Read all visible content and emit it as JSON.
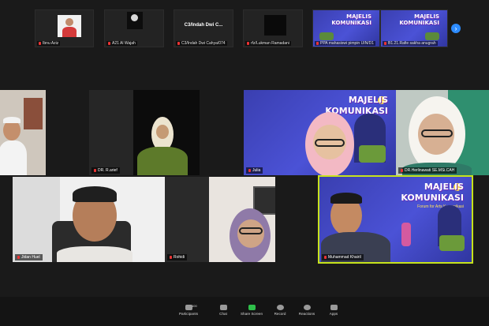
{
  "strip": {
    "thumbs": [
      {
        "name": "Ibnu Aziz"
      },
      {
        "name": "A21 Al Wajah"
      },
      {
        "name": "C3/Indah Dwi Cahya/074"
      },
      {
        "name": "rfz/Lukman Ramadani"
      },
      {
        "name": "PPA mahasiswi pimpin UIN/D1"
      },
      {
        "name": "B1.21.Rafie sakha anugrah"
      }
    ],
    "center_title": "C3/Indah Dwi C...",
    "banner": {
      "t1": "MAJELIS",
      "t2": "KOMUNIKASI"
    }
  },
  "tiles": {
    "r1c1": {
      "name": ""
    },
    "r1c2": {
      "name": "DR. R.arief"
    },
    "r1c3": {
      "name": "Julia"
    },
    "r1c4": {
      "name": "DR.Herlinawati SE.MSi.CAH"
    },
    "r2c1": {
      "name": "Jidan Huel"
    },
    "r2c2": {
      "name": "Rohidi"
    },
    "r2c3": {
      "name": "Muhammad Khairil"
    }
  },
  "banner": {
    "title1": "MAJELIS",
    "title2": "KOMUNIKASI",
    "subtitle": "Forum for Arts Komunikasi"
  },
  "toolbar": {
    "items": [
      {
        "label": "Participants",
        "count": "100"
      },
      {
        "label": "Chat"
      },
      {
        "label": "Share Screen"
      },
      {
        "label": "Record"
      },
      {
        "label": "Reactions"
      },
      {
        "label": "Apps"
      }
    ]
  },
  "colors": {
    "active_outline": "#c6e21c",
    "share_green": "#2fbf4a",
    "banner_blue": "#4b52d6"
  }
}
